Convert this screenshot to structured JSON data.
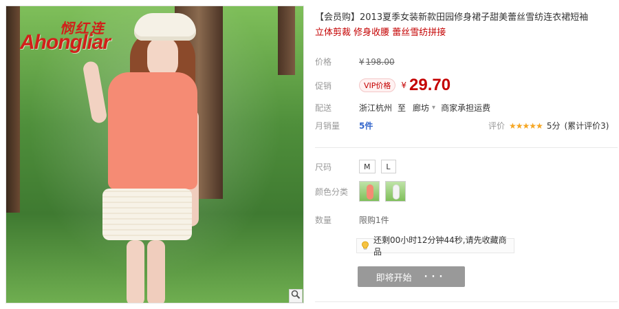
{
  "brand": {
    "cn": "悯红连",
    "en": "Ahongliar"
  },
  "product": {
    "title": "【会员购】2013夏季女装新款田园修身裙子甜美蕾丝雪纺连衣裙短袖",
    "subtitle": "立体剪裁 修身收腰 蕾丝雪纺拼接"
  },
  "price": {
    "label": "价格",
    "currency": "¥",
    "original": "198.00"
  },
  "promo": {
    "label": "促销",
    "badge": "VIP价格",
    "currency": "¥",
    "price": "29.70"
  },
  "shipping": {
    "label": "配送",
    "from": "浙江杭州",
    "to_word": "至",
    "to": "廊坊",
    "fee": "商家承担运费"
  },
  "sales": {
    "label": "月销量",
    "value": "5件"
  },
  "rating": {
    "label": "评价",
    "stars": "★★★★★",
    "score": "5分",
    "reviews": "(累计评价3)"
  },
  "options": {
    "size_label": "尺码",
    "sizes": [
      "M",
      "L"
    ],
    "color_label": "颜色分类",
    "quantity_label": "数量",
    "quantity_text": "限购1件"
  },
  "timer": {
    "text": "还剩00小时12分钟44秒,请先收藏商品"
  },
  "cta": {
    "label": "即将开始",
    "dots": "···"
  },
  "icons": {
    "zoom": "search-icon",
    "bulb": "lightbulb-icon",
    "dropdown": "chevron-down-icon"
  },
  "colors": {
    "accent_red": "#c40000",
    "link_blue": "#3366cc",
    "cta_gray": "#999999",
    "star_orange": "#f5a623"
  }
}
